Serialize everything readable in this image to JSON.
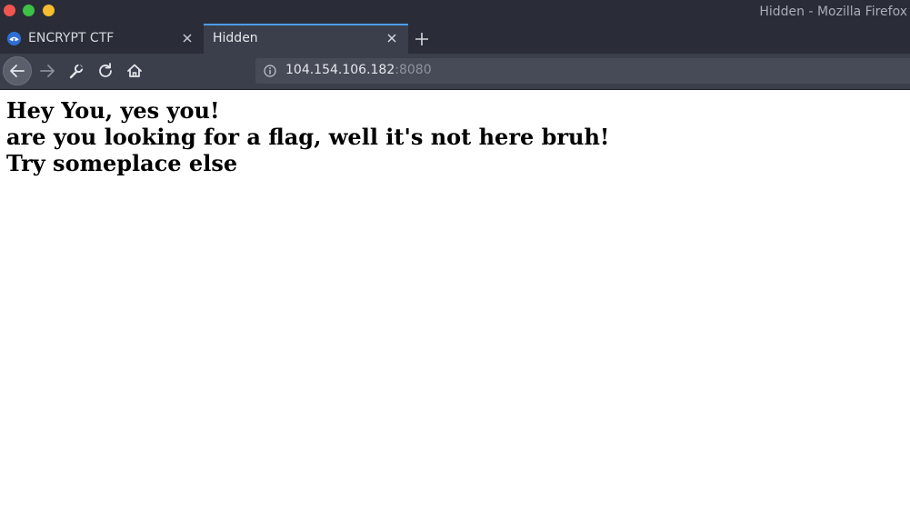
{
  "window": {
    "title": "Hidden - Mozilla Firefox"
  },
  "tabs": [
    {
      "label": "ENCRYPT CTF",
      "active": false,
      "icon": "ctf-favicon-icon"
    },
    {
      "label": "Hidden",
      "active": true
    }
  ],
  "navbar": {
    "url_host": "104.154.106.182",
    "url_port": ":8080"
  },
  "content": {
    "lines": [
      "Hey You, yes you!",
      "are you looking for a flag, well it's not here bruh!",
      "Try someplace else"
    ]
  },
  "colors": {
    "accent": "#4b9cf0",
    "chrome_dark": "#2a2d37",
    "chrome_mid": "#3b3f4b"
  }
}
